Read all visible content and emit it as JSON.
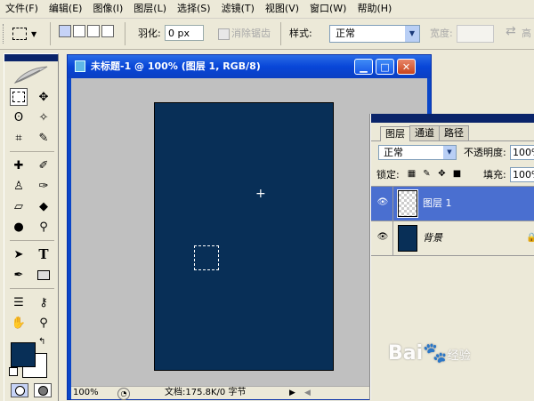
{
  "menu": [
    "文件(F)",
    "编辑(E)",
    "图像(I)",
    "图层(L)",
    "选择(S)",
    "滤镜(T)",
    "视图(V)",
    "窗口(W)",
    "帮助(H)"
  ],
  "options": {
    "feather_label": "羽化:",
    "feather_value": "0 px",
    "antialias_label": "消除锯齿",
    "style_label": "样式:",
    "style_value": "正常",
    "width_label": "宽度:",
    "height_label": "高"
  },
  "document": {
    "title": "未标题-1 @ 100% (图层 1, RGB/8)",
    "zoom": "100%",
    "info": "文档:175.8K/0 字节",
    "canvas_color": "#082f57"
  },
  "colors": {
    "foreground": "#082f57",
    "background": "#ffffff"
  },
  "layers_panel": {
    "tabs": [
      "图层",
      "通道",
      "路径"
    ],
    "blend_mode": "正常",
    "opacity_label": "不透明度:",
    "opacity": "100%",
    "lock_label": "锁定:",
    "fill_label": "填充:",
    "fill": "100%",
    "layers": [
      {
        "name": "图层 1",
        "selected": true,
        "thumb": "transparent"
      },
      {
        "name": "背景",
        "selected": false,
        "thumb": "#082f57",
        "locked": true
      }
    ]
  },
  "watermark": {
    "brand": "Bai",
    "suffix": "经验"
  }
}
